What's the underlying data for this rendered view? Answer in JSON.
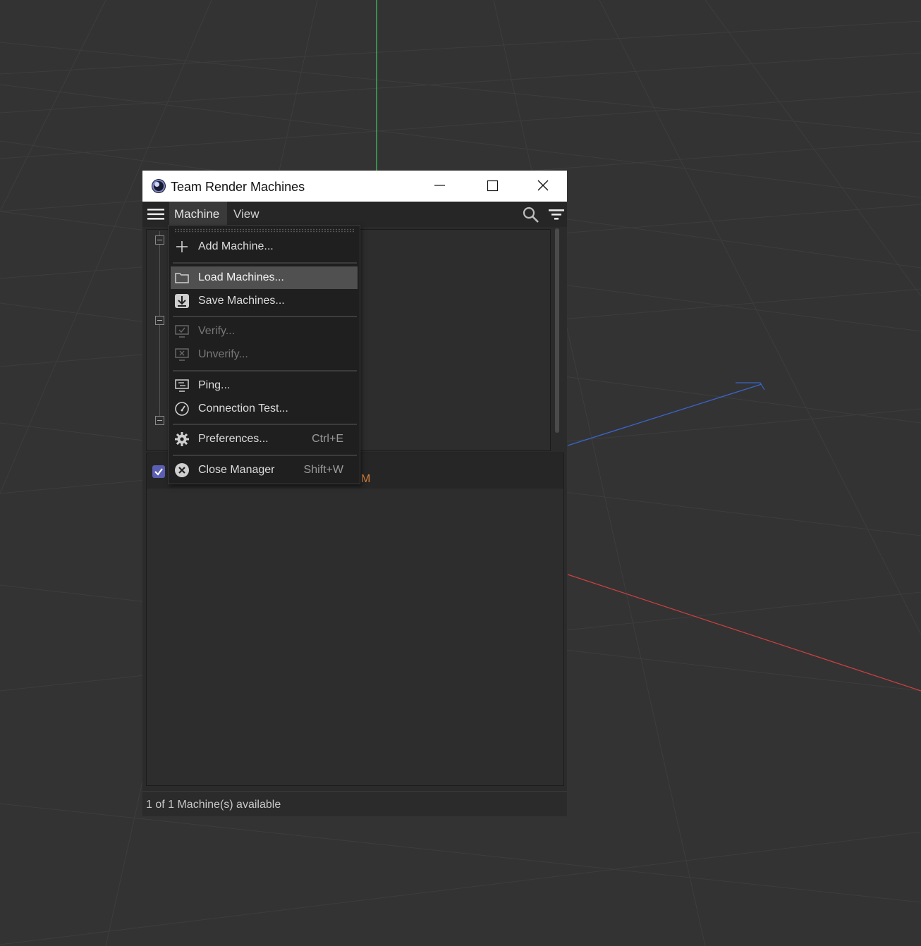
{
  "window": {
    "title": "Team Render Machines",
    "minimize_icon": "minimize-icon",
    "maximize_icon": "maximize-icon",
    "close_icon": "close-icon"
  },
  "menubar": {
    "menus": [
      "Machine",
      "View"
    ],
    "active_menu": "Machine"
  },
  "machine_menu": {
    "items": [
      {
        "label": "Add Machine...",
        "icon": "plus-icon",
        "shortcut": "",
        "state": "enabled"
      },
      {
        "label": "Load Machines...",
        "icon": "folder-icon",
        "shortcut": "",
        "state": "highlighted"
      },
      {
        "label": "Save Machines...",
        "icon": "download-icon",
        "shortcut": "",
        "state": "enabled"
      },
      {
        "label": "Verify...",
        "icon": "monitor-check-icon",
        "shortcut": "",
        "state": "disabled"
      },
      {
        "label": "Unverify...",
        "icon": "monitor-x-icon",
        "shortcut": "",
        "state": "disabled"
      },
      {
        "label": "Ping...",
        "icon": "monitor-ping-icon",
        "shortcut": "",
        "state": "enabled"
      },
      {
        "label": "Connection Test...",
        "icon": "gauge-icon",
        "shortcut": "",
        "state": "enabled"
      },
      {
        "label": "Preferences...",
        "icon": "gear-icon",
        "shortcut": "Ctrl+E",
        "state": "enabled"
      },
      {
        "label": "Close Manager",
        "icon": "close-circle-icon",
        "shortcut": "Shift+W",
        "state": "enabled"
      }
    ]
  },
  "details": {
    "row_fragment": "M",
    "checked": true
  },
  "status": {
    "text": "1 of 1 Machine(s) available"
  },
  "colors": {
    "accent_orange": "#d9823d",
    "checkbox": "#5b5fb3",
    "axis_y": "#3fbf5a",
    "axis_x": "#d04040",
    "axis_z": "#3a63c9"
  }
}
